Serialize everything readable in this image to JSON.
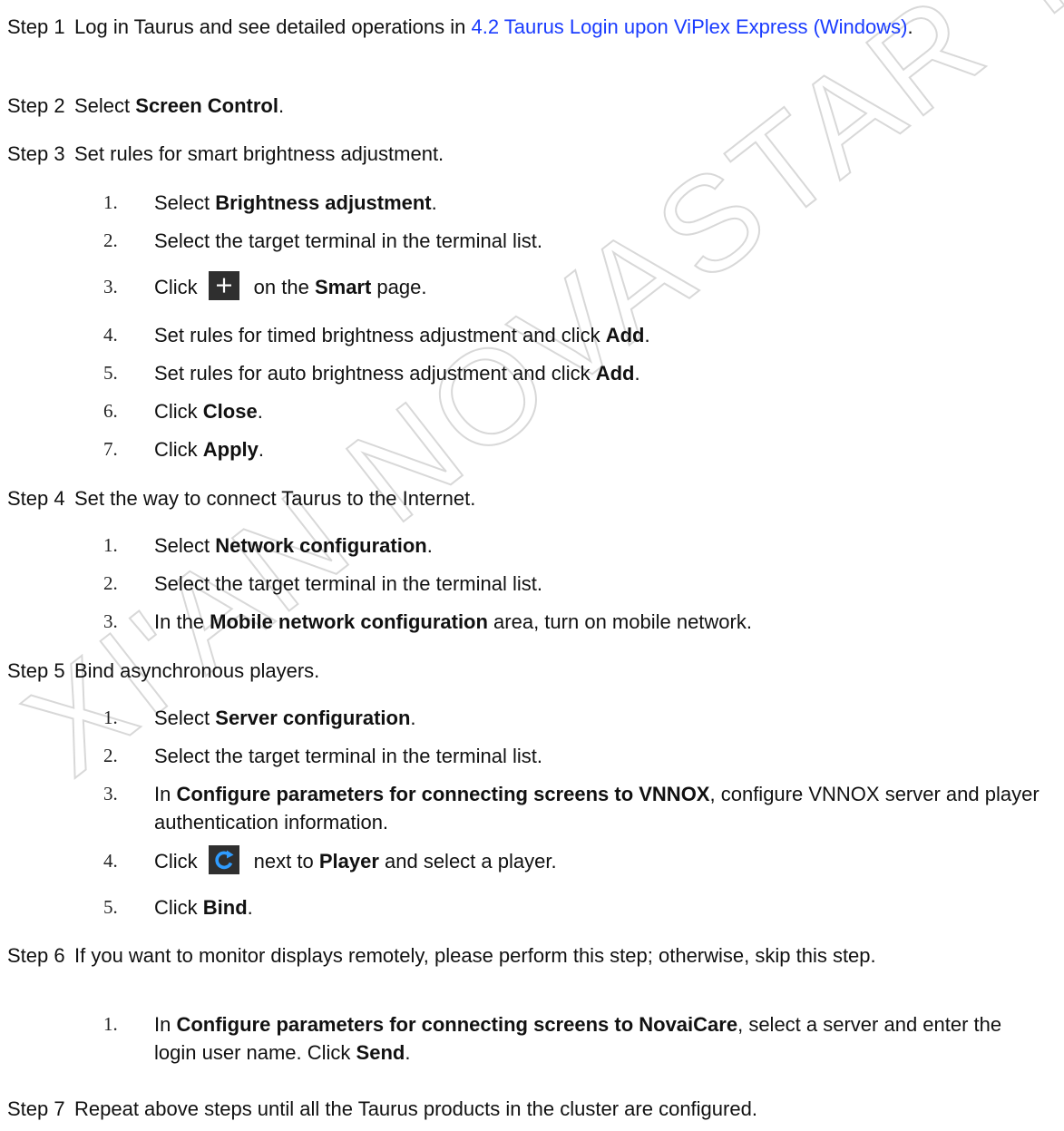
{
  "watermark": "XI'AN NOVASTAR TECH CO.,LTD.",
  "steps": [
    {
      "label": "Step 1",
      "text_before": "Log in Taurus and see detailed operations in ",
      "link": "4.2 Taurus Login upon ViPlex Express (Windows)",
      "text_after": "."
    },
    {
      "label": "Step 2",
      "text_before": "Select ",
      "bold": "Screen Control",
      "text_after": "."
    },
    {
      "label": "Step 3",
      "text": "Set rules for smart brightness adjustment.",
      "substeps": [
        {
          "num": "1.",
          "pre": "Select ",
          "bold": "Brightness adjustment",
          "post": "."
        },
        {
          "num": "2.",
          "pre": "Select the target terminal in the terminal list."
        },
        {
          "num": "3.",
          "pre": "Click",
          "icon": "plus-icon",
          "mid": "on the ",
          "bold": "Smart",
          "post": " page."
        },
        {
          "num": "4.",
          "pre": "Set rules for timed brightness adjustment and click ",
          "bold": "Add",
          "post": "."
        },
        {
          "num": "5.",
          "pre": "Set rules for auto brightness adjustment and click ",
          "bold": "Add",
          "post": "."
        },
        {
          "num": "6.",
          "pre": "Click ",
          "bold": "Close",
          "post": "."
        },
        {
          "num": "7.",
          "pre": "Click ",
          "bold": "Apply",
          "post": "."
        }
      ]
    },
    {
      "label": "Step 4",
      "text": "Set the way to connect Taurus to the Internet.",
      "substeps": [
        {
          "num": "1.",
          "pre": "Select ",
          "bold": "Network configuration",
          "post": "."
        },
        {
          "num": "2.",
          "pre": "Select the target terminal in the terminal list."
        },
        {
          "num": "3.",
          "pre": "In the ",
          "bold": "Mobile network configuration",
          "post": " area, turn on mobile network."
        }
      ]
    },
    {
      "label": "Step 5",
      "text": "Bind asynchronous players.",
      "substeps": [
        {
          "num": "1.",
          "pre": "Select ",
          "bold": "Server configuration",
          "post": "."
        },
        {
          "num": "2.",
          "pre": "Select the target terminal in the terminal list."
        },
        {
          "num": "3.",
          "pre": "In ",
          "bold": "Configure parameters for connecting screens to VNNOX",
          "post": ", configure VNNOX server and player authentication information."
        },
        {
          "num": "4.",
          "pre": "Click",
          "icon": "refresh-icon",
          "mid": "next to ",
          "bold": "Player",
          "post": " and select a player."
        },
        {
          "num": "5.",
          "pre": "Click ",
          "bold": "Bind",
          "post": "."
        }
      ]
    },
    {
      "label": "Step 6",
      "text": "If you want to monitor displays remotely, please perform this step; otherwise, skip this step.",
      "substeps": [
        {
          "num": "1.",
          "pre": "In ",
          "bold": "Configure parameters for connecting screens to NovaiCare",
          "post": ", select a server and enter the login user name. Click ",
          "bold2": "Send",
          "post2": "."
        }
      ]
    },
    {
      "label": "Step 7",
      "text": "Repeat above steps until all the Taurus products in the cluster are configured."
    }
  ]
}
